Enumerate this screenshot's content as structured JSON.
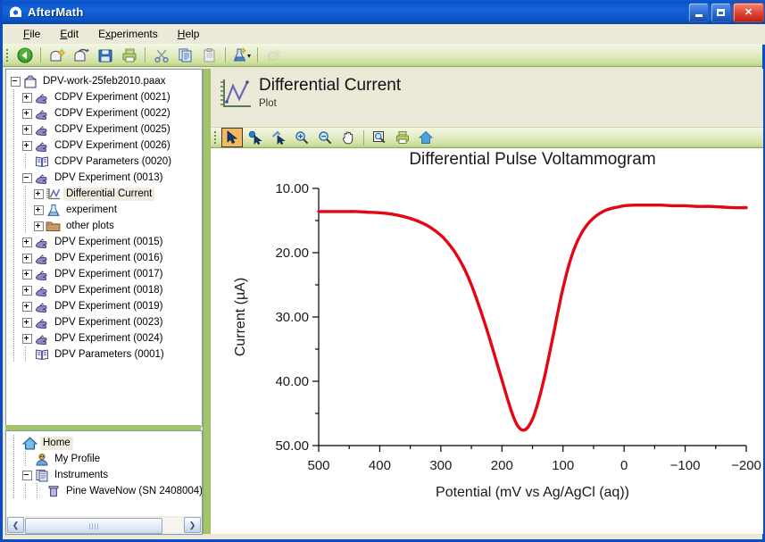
{
  "window": {
    "title": "AfterMath",
    "logo_icon": "aftermath-dome-logo-icon",
    "minimize_label": "Minimize",
    "maximize_label": "Maximize",
    "close_label": "Close"
  },
  "menubar": {
    "items": [
      {
        "label": "File",
        "accel": "F",
        "name": "menu-file"
      },
      {
        "label": "Edit",
        "accel": "E",
        "name": "menu-edit"
      },
      {
        "label": "Experiments",
        "accel": "x",
        "name": "menu-experiments"
      },
      {
        "label": "Help",
        "accel": "H",
        "name": "menu-help"
      }
    ]
  },
  "toolbar": {
    "buttons": [
      {
        "icon": "back-arrow-icon",
        "name": "back-button",
        "enabled": true
      },
      {
        "icon": "new-archive-icon",
        "name": "new-archive-button",
        "enabled": true
      },
      {
        "icon": "open-archive-icon",
        "name": "open-archive-button",
        "enabled": true
      },
      {
        "icon": "save-icon",
        "name": "save-button",
        "enabled": true
      },
      {
        "icon": "print-icon",
        "name": "print-button",
        "enabled": true
      },
      {
        "icon": "cut-scissors-icon",
        "name": "cut-button",
        "enabled": true
      },
      {
        "icon": "copy-icon",
        "name": "copy-button",
        "enabled": true
      },
      {
        "icon": "paste-icon",
        "name": "paste-button",
        "enabled": true
      },
      {
        "icon": "experiment-flask-wizard-icon",
        "name": "new-experiment-button",
        "enabled": true
      },
      {
        "icon": "disabled-star-icon",
        "name": "disabled-tool-button",
        "enabled": false
      }
    ]
  },
  "archive_tree": {
    "root": {
      "label": "DPV-work-25feb2010.paax",
      "icon": "archive-icon",
      "expander": "minus"
    },
    "items": [
      {
        "label": "CDPV Experiment (0021)",
        "icon": "experiment-hand-icon",
        "expander": "plus",
        "depth": 1
      },
      {
        "label": "CDPV Experiment (0022)",
        "icon": "experiment-hand-icon",
        "expander": "plus",
        "depth": 1
      },
      {
        "label": "CDPV Experiment (0025)",
        "icon": "experiment-hand-icon",
        "expander": "plus",
        "depth": 1
      },
      {
        "label": "CDPV Experiment (0026)",
        "icon": "experiment-hand-icon",
        "expander": "plus",
        "depth": 1
      },
      {
        "label": "CDPV Parameters (0020)",
        "icon": "parameters-book-icon",
        "expander": "none",
        "depth": 1
      },
      {
        "label": "DPV Experiment (0013)",
        "icon": "experiment-hand-icon",
        "expander": "minus",
        "depth": 1
      },
      {
        "label": "Differential Current",
        "icon": "plot-icon",
        "expander": "plus",
        "depth": 2,
        "selected": true
      },
      {
        "label": "experiment",
        "icon": "flask-icon",
        "expander": "plus",
        "depth": 2
      },
      {
        "label": "other plots",
        "icon": "folder-icon",
        "expander": "plus",
        "depth": 2
      },
      {
        "label": "DPV Experiment (0015)",
        "icon": "experiment-hand-icon",
        "expander": "plus",
        "depth": 1
      },
      {
        "label": "DPV Experiment (0016)",
        "icon": "experiment-hand-icon",
        "expander": "plus",
        "depth": 1
      },
      {
        "label": "DPV Experiment (0017)",
        "icon": "experiment-hand-icon",
        "expander": "plus",
        "depth": 1
      },
      {
        "label": "DPV Experiment (0018)",
        "icon": "experiment-hand-icon",
        "expander": "plus",
        "depth": 1
      },
      {
        "label": "DPV Experiment (0019)",
        "icon": "experiment-hand-icon",
        "expander": "plus",
        "depth": 1
      },
      {
        "label": "DPV Experiment (0023)",
        "icon": "experiment-hand-icon",
        "expander": "plus",
        "depth": 1
      },
      {
        "label": "DPV Experiment (0024)",
        "icon": "experiment-hand-icon",
        "expander": "plus",
        "depth": 1
      },
      {
        "label": "DPV Parameters (0001)",
        "icon": "parameters-book-icon",
        "expander": "none",
        "depth": 1
      }
    ]
  },
  "home_tree": {
    "items": [
      {
        "label": "Home",
        "icon": "home-icon",
        "expander": "none",
        "depth": 0,
        "selected": true
      },
      {
        "label": "My Profile",
        "icon": "profile-icon",
        "expander": "none",
        "depth": 1
      },
      {
        "label": "Instruments",
        "icon": "instruments-icon",
        "expander": "minus",
        "depth": 1
      },
      {
        "label": "Pine WaveNow (SN 2408004)",
        "icon": "instrument-device-icon",
        "expander": "none",
        "depth": 2
      }
    ]
  },
  "scrollbar": {
    "left_arrow": "❮",
    "right_arrow": "❯"
  },
  "plot_panel": {
    "icon": "plot-icon",
    "title": "Differential Current",
    "subtitle": "Plot",
    "tools": [
      {
        "icon": "select-arrow-icon",
        "name": "tool-select",
        "active": true
      },
      {
        "icon": "point-select-icon",
        "name": "tool-point-select",
        "active": false
      },
      {
        "icon": "trace-select-icon",
        "name": "tool-trace-select",
        "active": false
      },
      {
        "icon": "zoom-in-icon",
        "name": "tool-zoom-in",
        "active": false
      },
      {
        "icon": "zoom-out-icon",
        "name": "tool-zoom-out",
        "active": false
      },
      {
        "icon": "pan-hand-icon",
        "name": "tool-pan",
        "active": false
      },
      {
        "icon": "zoom-region-icon",
        "name": "tool-zoom-region",
        "active": false
      },
      {
        "icon": "print-icon",
        "name": "tool-print",
        "active": false
      },
      {
        "icon": "home-reset-icon",
        "name": "tool-reset-view",
        "active": false
      }
    ]
  },
  "chart_data": {
    "type": "line",
    "title": "Differential Pulse Voltammogram",
    "xlabel": "Potential (mV vs Ag/AgCl (aq))",
    "ylabel": "Current (µA)",
    "xlim": [
      500,
      -200
    ],
    "ylim": [
      10.0,
      50.0
    ],
    "y_inverted": true,
    "grid": false,
    "legend": false,
    "x_ticks": [
      500,
      400,
      300,
      200,
      100,
      0,
      -100,
      -200
    ],
    "x_tick_labels": [
      "500",
      "400",
      "300",
      "200",
      "100",
      "0",
      "−100",
      "−200"
    ],
    "y_ticks": [
      10.0,
      20.0,
      30.0,
      40.0,
      50.0
    ],
    "y_tick_labels": [
      "10.00",
      "20.00",
      "30.00",
      "40.00",
      "50.00"
    ],
    "y_minor_ticks": [
      15.0,
      25.0,
      35.0,
      45.0
    ],
    "series": [
      {
        "name": "Differential Current",
        "color": "#e30613",
        "x": [
          500,
          480,
          460,
          440,
          420,
          400,
          380,
          360,
          340,
          320,
          300,
          290,
          280,
          270,
          260,
          250,
          240,
          230,
          220,
          210,
          200,
          195,
          190,
          185,
          180,
          175,
          170,
          165,
          160,
          155,
          150,
          145,
          140,
          135,
          130,
          125,
          120,
          115,
          110,
          105,
          100,
          90,
          80,
          70,
          60,
          50,
          40,
          30,
          20,
          10,
          0,
          -20,
          -40,
          -60,
          -80,
          -100,
          -120,
          -140,
          -160,
          -180,
          -200
        ],
        "y": [
          13.6,
          13.6,
          13.6,
          13.6,
          13.7,
          13.8,
          14.0,
          14.4,
          15.0,
          15.9,
          17.3,
          18.3,
          19.5,
          21.0,
          22.8,
          25.0,
          27.6,
          30.4,
          33.4,
          36.6,
          39.8,
          41.4,
          43.0,
          44.5,
          45.8,
          46.8,
          47.4,
          47.6,
          47.4,
          46.8,
          45.9,
          44.6,
          43.0,
          41.2,
          39.2,
          37.0,
          34.7,
          32.4,
          30.0,
          27.7,
          25.5,
          21.8,
          19.0,
          17.0,
          15.6,
          14.6,
          13.9,
          13.4,
          13.1,
          12.9,
          12.7,
          12.6,
          12.6,
          12.6,
          12.7,
          12.7,
          12.8,
          12.8,
          12.9,
          13.0,
          13.0
        ]
      }
    ]
  }
}
